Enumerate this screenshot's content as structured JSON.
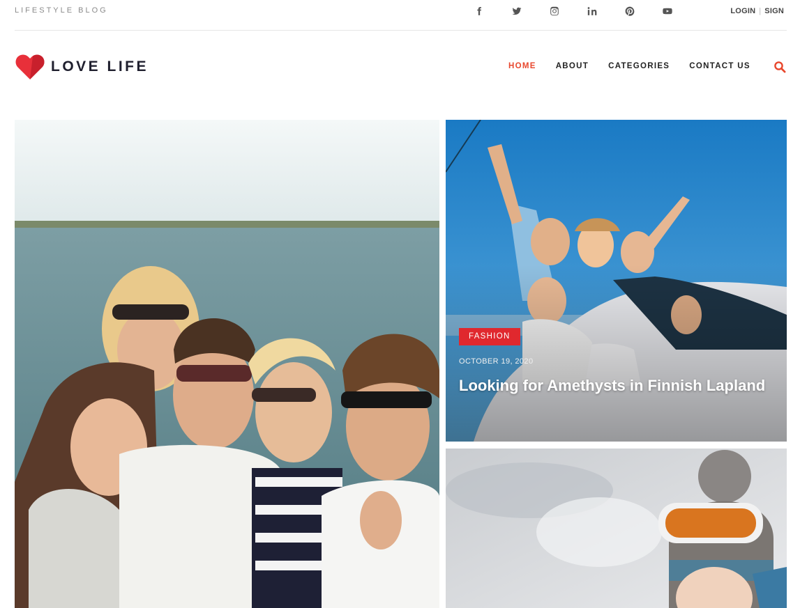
{
  "topbar": {
    "tagline": "LIFESTYLE BLOG",
    "social_icons": [
      "facebook-icon",
      "twitter-icon",
      "instagram-icon",
      "linkedin-icon",
      "pinterest-icon",
      "youtube-icon"
    ],
    "login_label": "LOGIN",
    "signup_label": "SIGN"
  },
  "header": {
    "logo_text": "LOVE LIFE",
    "nav": [
      {
        "label": "HOME",
        "active": true
      },
      {
        "label": "ABOUT",
        "active": false
      },
      {
        "label": "CATEGORIES",
        "active": false
      },
      {
        "label": "CONTACT US",
        "active": false
      }
    ]
  },
  "featured": {
    "category": "FASHION",
    "date": "OCTOBER 19, 2020",
    "title": "Looking for Amethysts in Finnish Lapland"
  },
  "colors": {
    "accent": "#e8472d",
    "badge": "#e0282e",
    "logo_heart": "#e8303a"
  }
}
